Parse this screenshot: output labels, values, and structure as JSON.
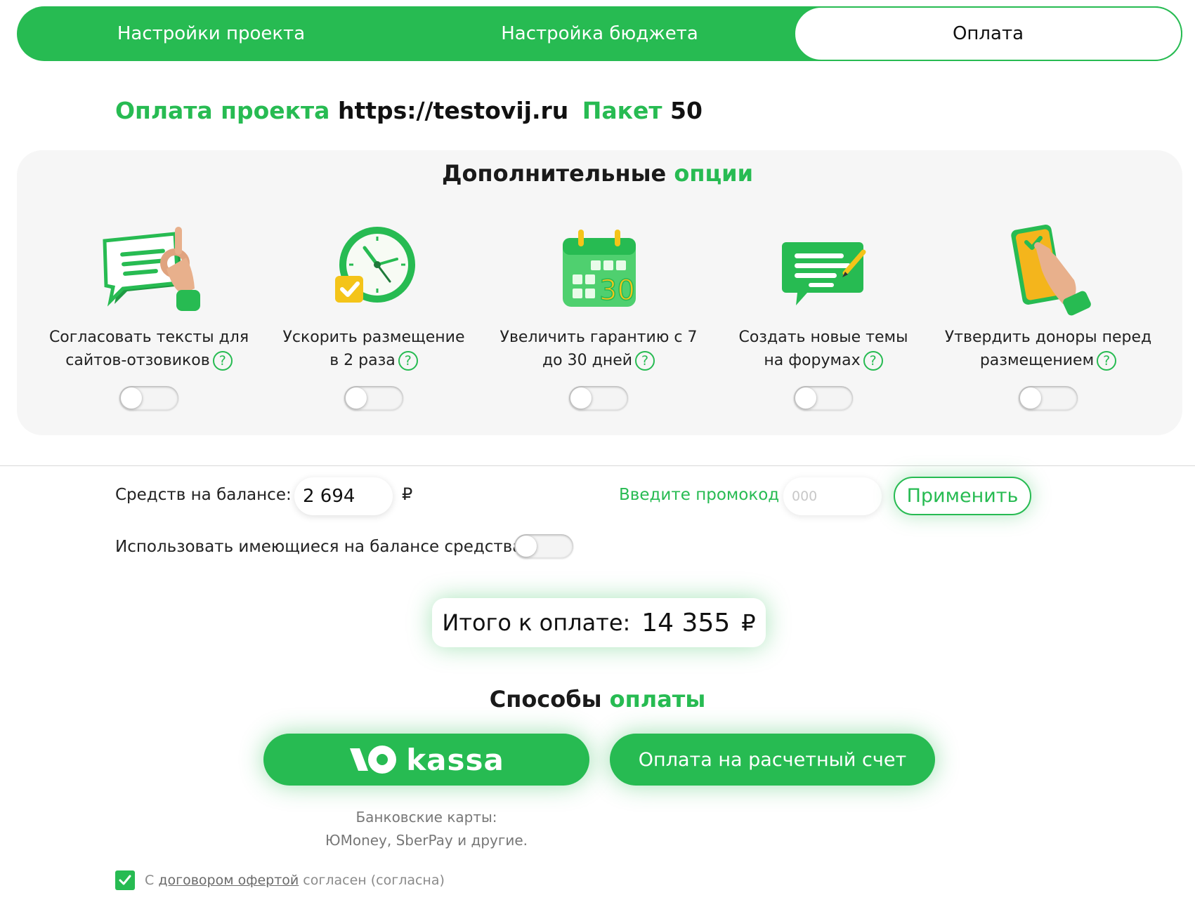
{
  "stepper": {
    "step1": "Настройки проекта",
    "step2": "Настройка бюджета",
    "step3": "Оплата"
  },
  "project": {
    "label": "Оплата проекта",
    "url": "https://testovij.ru",
    "package_label": "Пакет",
    "package_value": "50"
  },
  "options": {
    "title_a": "Дополнительные",
    "title_b": "опции",
    "items": [
      {
        "line1": "Согласовать тексты для",
        "line2": "сайтов-отзовиков",
        "icon": "ok-hand-chat-icon"
      },
      {
        "line1": "Ускорить размещение",
        "line2": "в 2 раза",
        "icon": "clock-icon"
      },
      {
        "line1": "Увеличить гарантию с 7",
        "line2": "до 30 дней",
        "icon": "calendar-30-icon"
      },
      {
        "line1": "Создать новые темы",
        "line2": "на форумах",
        "icon": "forum-message-icon"
      },
      {
        "line1": "Утвердить доноры перед",
        "line2": "размещением",
        "icon": "tablet-approve-icon"
      }
    ],
    "help_glyph": "?"
  },
  "balance": {
    "label": "Средств на балансе:",
    "value": "2 694",
    "currency": "₽",
    "use_label": "Использовать имеющиеся на балансе средства"
  },
  "promo": {
    "label": "Введите промокод",
    "placeholder": "000",
    "apply": "Применить"
  },
  "total": {
    "label": "Итого к оплате:",
    "amount": "14 355",
    "currency": "₽"
  },
  "methods": {
    "title_a": "Способы",
    "title_b": "оплаты",
    "yookassa_word": "kassa",
    "bank": "Оплата на расчетный счет",
    "cards_line1": "Банковские карты:",
    "cards_line2": "ЮMoney, SberPay и другие."
  },
  "agreement": {
    "prefix": "С",
    "link": "договором офертой",
    "suffix": "согласен (согласна)"
  },
  "colors": {
    "accent": "#27bb52",
    "panel": "#f6f6f6"
  }
}
